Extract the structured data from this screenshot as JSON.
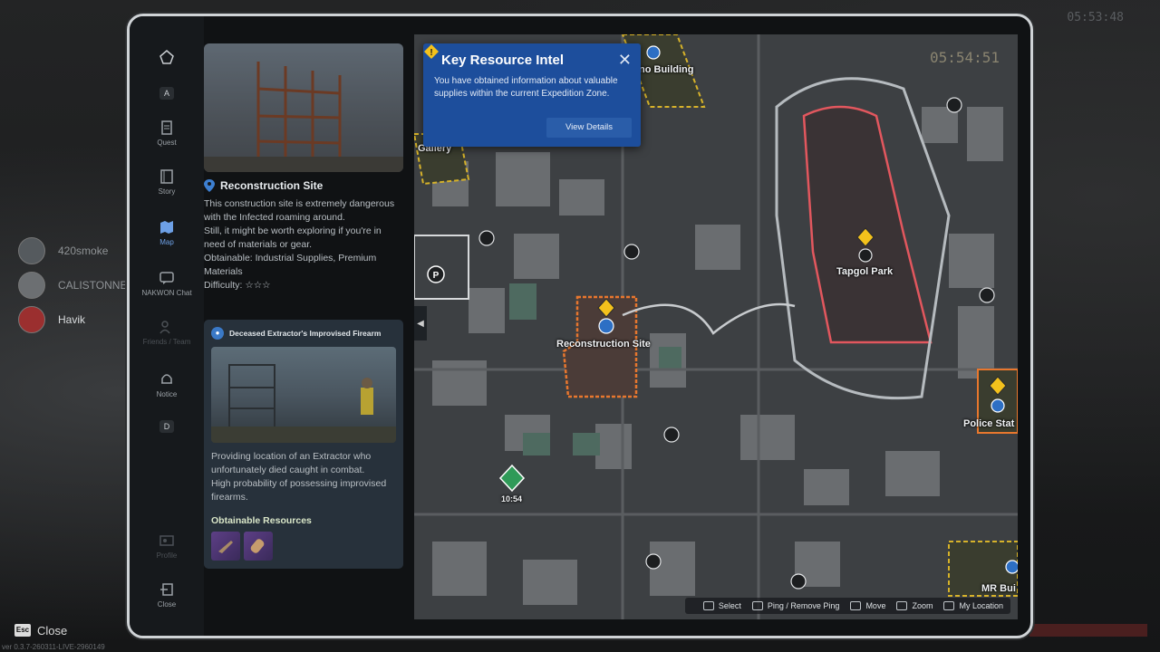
{
  "clock": "05:53:48",
  "players": [
    {
      "name": "420smoke",
      "active": false
    },
    {
      "name": "CALISTONNER",
      "active": false
    },
    {
      "name": "Havik",
      "active": true
    }
  ],
  "footer": {
    "esc_key": "Esc",
    "close_label": "Close",
    "version": "ver 0.3.7-260311-LIVE-2960149"
  },
  "rail": {
    "top_key": "A",
    "bottom_key": "D",
    "items": [
      {
        "label": "Quest",
        "icon": "quest-icon"
      },
      {
        "label": "Story",
        "icon": "book-icon"
      },
      {
        "label": "Map",
        "icon": "map-icon"
      },
      {
        "label": "NAKWON Chat",
        "icon": "chat-icon"
      },
      {
        "label": "Friends / Team",
        "icon": "people-icon"
      },
      {
        "label": "Notice",
        "icon": "bell-icon"
      },
      {
        "label": "Profile",
        "icon": "profile-icon"
      },
      {
        "label": "Close",
        "icon": "exit-icon"
      }
    ]
  },
  "site": {
    "title": "Reconstruction Site",
    "desc_lines": [
      "This construction site is extremely dangerous",
      "with the Infected roaming around.",
      "Still, it might be worth exploring if you're in",
      "need of materials or gear."
    ],
    "obtainable_line1": "Obtainable: Industrial Supplies, Premium",
    "obtainable_line2": "Materials",
    "difficulty": "Difficulty: ☆☆☆"
  },
  "card": {
    "title": "Deceased Extractor's Improvised Firearm",
    "text_lines": [
      "Providing location of an Extractor who",
      "unfortunately died caught in combat.",
      "High probability of possessing improvised",
      "firearms."
    ],
    "resources_title": "Obtainable Resources",
    "resources": [
      "firearm-icon",
      "ammo-icon"
    ]
  },
  "map": {
    "timer": "05:54:51",
    "labels": {
      "building": "no Building",
      "gallery": "Gallery",
      "park": "Tapgol Park",
      "site": "Reconstruction Site",
      "police": "Police Stat",
      "mr": "MR Bui",
      "extract_time": "10:54"
    },
    "popup": {
      "title": "Key Resource Intel",
      "body_line1": "You have obtained information about valuable",
      "body_line2": "supplies within the current Expedition Zone.",
      "button": "View Details"
    },
    "controls": [
      {
        "label": "Select"
      },
      {
        "label": "Ping / Remove Ping"
      },
      {
        "label": "Move"
      },
      {
        "label": "Zoom"
      },
      {
        "label": "My Location"
      }
    ]
  }
}
